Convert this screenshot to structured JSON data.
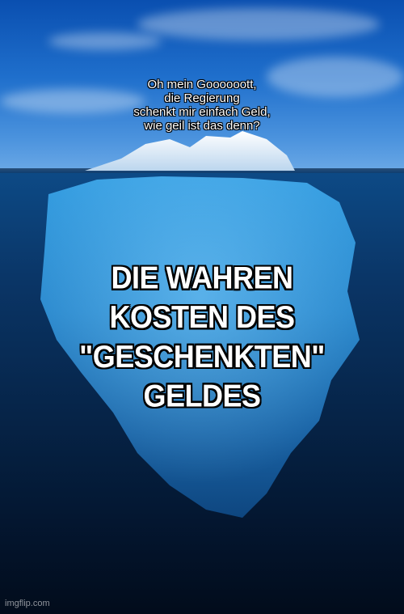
{
  "caption_top": {
    "lines": [
      "Oh mein Goooooott,",
      "die Regierung",
      "schenkt mir einfach Geld,",
      "wie geil ist das denn?"
    ]
  },
  "caption_main": {
    "lines": [
      "DIE WAHREN",
      "KOSTEN DES",
      "\"GESCHENKTEN\"",
      "GELDES"
    ]
  },
  "watermark": "imgflip.com",
  "colors": {
    "sky": "#1f6fcc",
    "sea": "#062448",
    "iceberg": "#2f9ae0",
    "text": "#ffffff",
    "outline": "#000000"
  }
}
